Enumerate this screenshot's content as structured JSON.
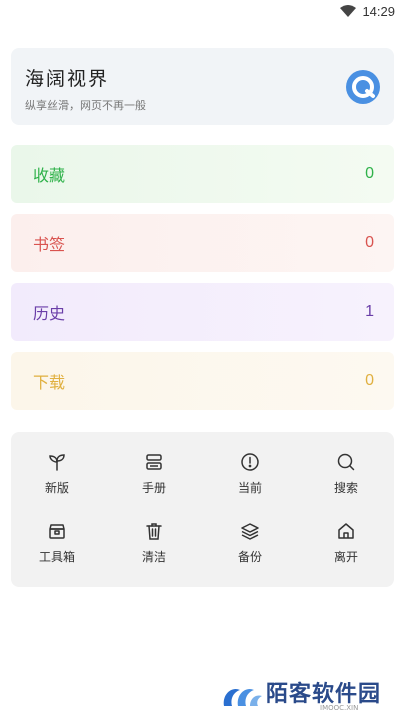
{
  "status_bar": {
    "time": "14:29"
  },
  "header": {
    "title": "海阔视界",
    "subtitle": "纵享丝滑，网页不再一般",
    "logo_color": "#4a90e2"
  },
  "stats": [
    {
      "label": "收藏",
      "value": "0",
      "color": "#2fb24a"
    },
    {
      "label": "书签",
      "value": "0",
      "color": "#d9534f"
    },
    {
      "label": "历史",
      "value": "1",
      "color": "#6a3ea8"
    },
    {
      "label": "下载",
      "value": "0",
      "color": "#e0b040"
    }
  ],
  "tools": [
    {
      "label": "新版",
      "icon": "sprout-icon"
    },
    {
      "label": "手册",
      "icon": "manual-icon"
    },
    {
      "label": "当前",
      "icon": "info-circle-icon"
    },
    {
      "label": "搜索",
      "icon": "search-icon"
    },
    {
      "label": "工具箱",
      "icon": "toolbox-icon"
    },
    {
      "label": "清洁",
      "icon": "trash-icon"
    },
    {
      "label": "备份",
      "icon": "layers-icon"
    },
    {
      "label": "离开",
      "icon": "home-icon"
    }
  ],
  "watermark": {
    "text": "陌客软件园",
    "sub": "IMOOC.XIN"
  }
}
